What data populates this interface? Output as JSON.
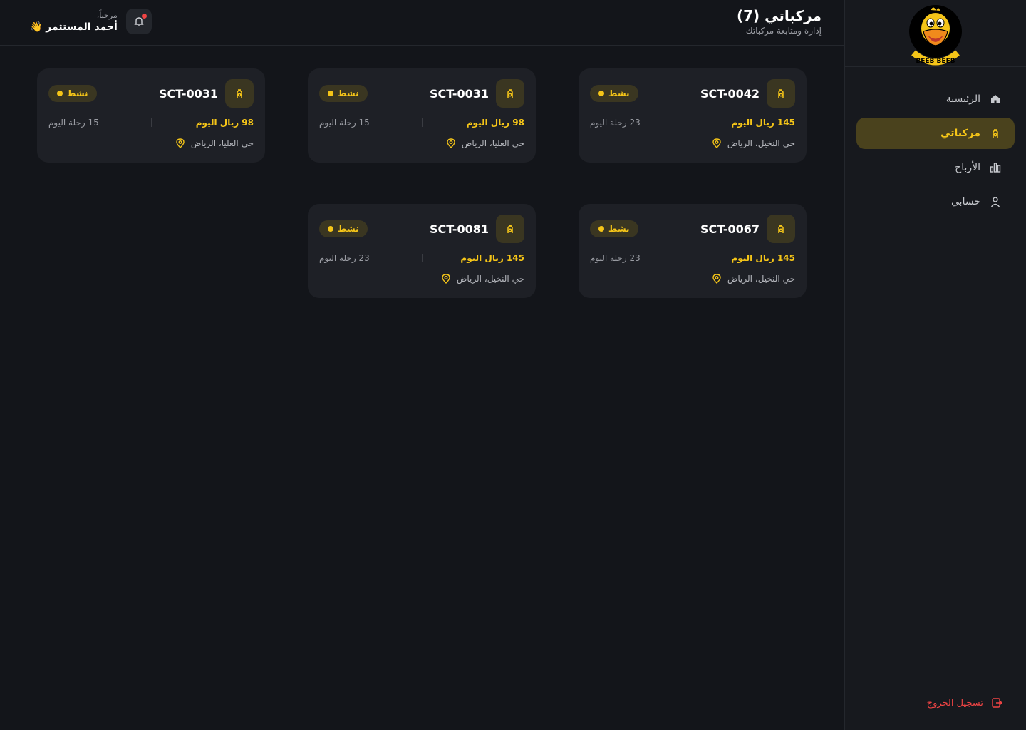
{
  "header": {
    "title": "مركباتي (7)",
    "subtitle": "إدارة ومتابعة مركباتك",
    "greeting": "مرحباً،",
    "user_name": "أحمد المستثمر 👋"
  },
  "logo": {
    "text": "BEEB BEEB"
  },
  "sidebar": {
    "items": [
      {
        "label": "الرئيسية",
        "icon": "home-icon"
      },
      {
        "label": "مركباتي",
        "icon": "scooter-icon",
        "active": true
      },
      {
        "label": "الأرباح",
        "icon": "bar-chart-icon"
      },
      {
        "label": "حسابي",
        "icon": "user-icon"
      }
    ],
    "logout_label": "تسجيل الخروج"
  },
  "vehicles": [
    {
      "id": "SCT-0042",
      "status": "نشط",
      "earnings": "145 ريال اليوم",
      "trips": "23 رحلة اليوم",
      "location": "حي النخيل، الرياض"
    },
    {
      "id": "SCT-0031",
      "status": "نشط",
      "earnings": "98 ريال اليوم",
      "trips": "15 رحلة اليوم",
      "location": "حي العليا، الرياض"
    },
    {
      "id": "SCT-0031",
      "status": "نشط",
      "earnings": "98 ريال اليوم",
      "trips": "15 رحلة اليوم",
      "location": "حي العليا، الرياض"
    },
    {
      "id": "SCT-0067",
      "status": "نشط",
      "earnings": "145 ريال اليوم",
      "trips": "23 رحلة اليوم",
      "location": "حي النخيل، الرياض"
    },
    {
      "id": "SCT-0081",
      "status": "نشط",
      "earnings": "145 ريال اليوم",
      "trips": "23 رحلة اليوم",
      "location": "حي النخيل، الرياض"
    }
  ],
  "colors": {
    "accent": "#f5c518",
    "background": "#13151a",
    "card": "#1e2026",
    "danger": "#ef4444"
  }
}
